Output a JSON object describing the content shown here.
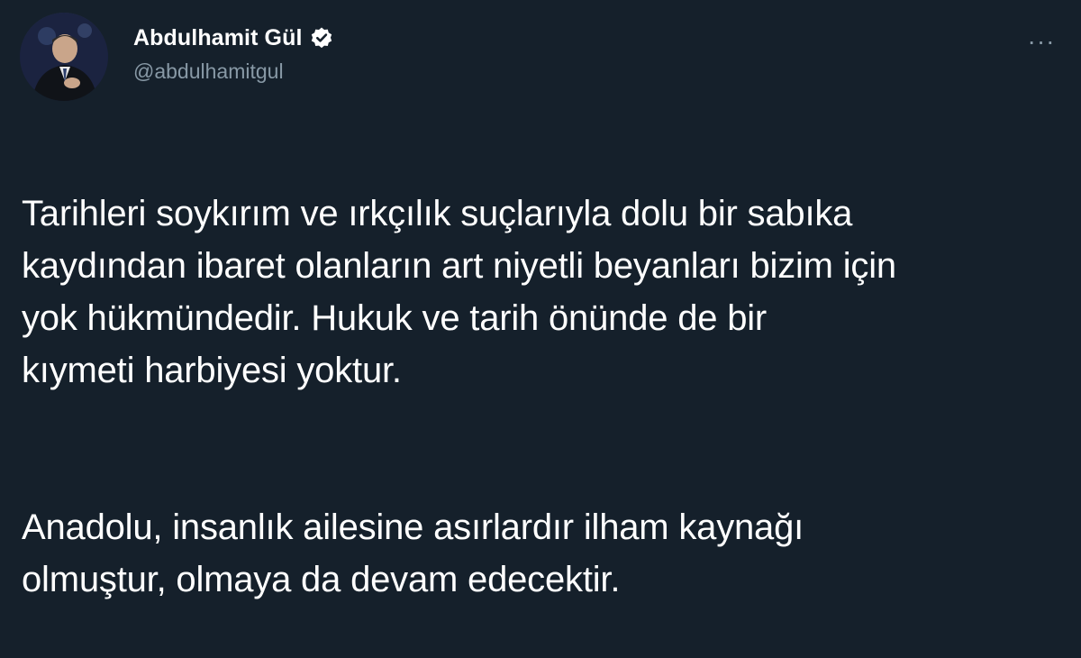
{
  "author": {
    "display_name": "Abdulhamit Gül",
    "handle": "@abdulhamitgul",
    "verified": true
  },
  "menu": {
    "more_icon": "more-horizontal-icon",
    "glyph": "···"
  },
  "tweet": {
    "paragraphs": [
      "Tarihleri soykırım ve ırkçılık suçlarıyla dolu bir sabıka\nkaydından ibaret olanların art niyetli beyanları bizim için\nyok hükmündedir. Hukuk ve tarih önünde de bir\nkıymeti harbiyesi yoktur.",
      "Anadolu, insanlık ailesine asırlardır ilham kaynağı\nolmuştur, olmaya da devam edecektir."
    ]
  },
  "colors": {
    "background": "#15202b",
    "text_primary": "#ffffff",
    "text_secondary": "#8899a6"
  }
}
